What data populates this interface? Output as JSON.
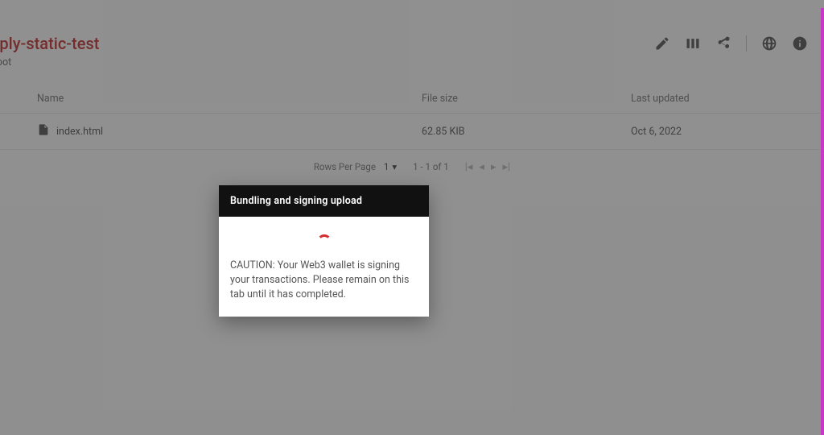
{
  "header": {
    "title": "mply-static-test",
    "breadcrumb": "e root"
  },
  "table": {
    "columns": {
      "name": "Name",
      "size": "File size",
      "updated": "Last updated"
    },
    "rows": [
      {
        "name": "index.html",
        "size": "62.85 KIB",
        "updated": "Oct 6, 2022"
      }
    ]
  },
  "pagination": {
    "rows_per_page_label": "Rows Per Page",
    "rows_per_page_value": "1",
    "range": "1 - 1 of 1"
  },
  "modal": {
    "title": "Bundling and signing upload",
    "body": "CAUTION: Your Web3 wallet is signing your transactions. Please remain on this tab until it has completed."
  }
}
